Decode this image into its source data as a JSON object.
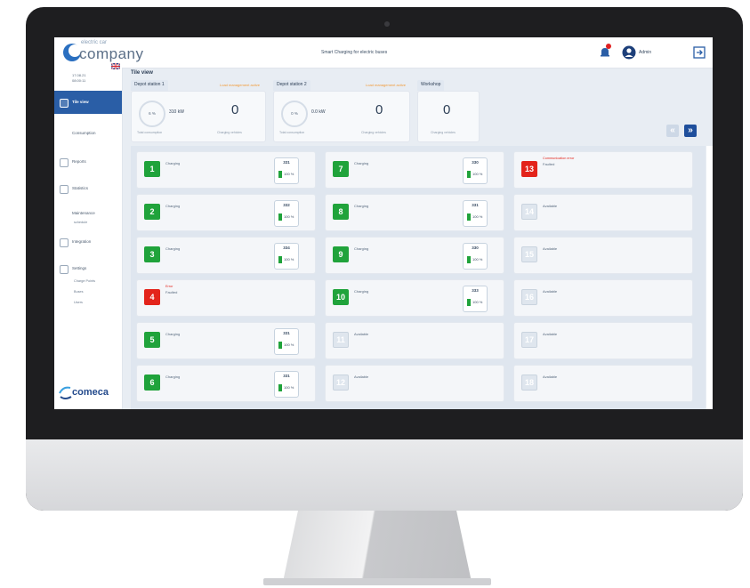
{
  "app": {
    "logo_small": "electric car",
    "logo_big": "company",
    "title": "Smart Charging for electric buses",
    "user_name": "Admin",
    "brand": "comeca"
  },
  "sidebar": {
    "info_line1": "17.08.21",
    "info_line2": "08:00:11",
    "items": [
      {
        "label": "Tile view"
      },
      {
        "label": "Consumption"
      },
      {
        "label": "Reports"
      },
      {
        "label": "Statistics"
      },
      {
        "label": "Maintenance"
      },
      {
        "label": "Integration"
      },
      {
        "label": "Settings"
      }
    ],
    "maintenance_sub": "schedule",
    "settings_sub": [
      "Charge Points",
      "Buses",
      "Users"
    ]
  },
  "main": {
    "view_title": "Tile view",
    "sections": [
      {
        "tab": "Depot station 1",
        "status": "Load management active",
        "gauge": "6 %",
        "power": "310 kW",
        "count": "0",
        "cap_left": "Total consumption",
        "cap_right": "Charging vehicles"
      },
      {
        "tab": "Depot station 2",
        "status": "Load management active",
        "gauge": "0 %",
        "power": "0.0 kW",
        "count": "0",
        "cap_left": "Total consumption",
        "cap_right": "Charging vehicles"
      },
      {
        "tab": "Workshop",
        "count": "0",
        "cap_right": "Charging vehicles"
      }
    ],
    "nav_prev": "«",
    "nav_next": "»",
    "tiles": [
      {
        "num": "1",
        "state": "g",
        "status": "Charging",
        "kw": "331",
        "pct": "100 %"
      },
      {
        "num": "7",
        "state": "g",
        "status": "Charging",
        "kw": "330",
        "pct": "100 %"
      },
      {
        "num": "13",
        "state": "r",
        "alert": "Communication error",
        "status": "Faulted"
      },
      {
        "num": "2",
        "state": "g",
        "status": "Charging",
        "kw": "332",
        "pct": "100 %"
      },
      {
        "num": "8",
        "state": "g",
        "status": "Charging",
        "kw": "331",
        "pct": "100 %"
      },
      {
        "num": "14",
        "state": "n",
        "status": "Available"
      },
      {
        "num": "3",
        "state": "g",
        "status": "Charging",
        "kw": "334",
        "pct": "100 %"
      },
      {
        "num": "9",
        "state": "g",
        "status": "Charging",
        "kw": "330",
        "pct": "100 %"
      },
      {
        "num": "15",
        "state": "n",
        "status": "Available"
      },
      {
        "num": "4",
        "state": "r",
        "alert": "Error",
        "status": "Faulted"
      },
      {
        "num": "10",
        "state": "g",
        "status": "Charging",
        "kw": "333",
        "pct": "100 %"
      },
      {
        "num": "16",
        "state": "n",
        "status": "Available"
      },
      {
        "num": "5",
        "state": "g",
        "status": "Charging",
        "kw": "331",
        "pct": "100 %"
      },
      {
        "num": "11",
        "state": "n",
        "status": "Available"
      },
      {
        "num": "17",
        "state": "n",
        "status": "Available"
      },
      {
        "num": "6",
        "state": "g",
        "status": "Charging",
        "kw": "331",
        "pct": "100 %"
      },
      {
        "num": "12",
        "state": "n",
        "status": "Available"
      },
      {
        "num": "18",
        "state": "n",
        "status": "Available"
      }
    ]
  },
  "colors": {
    "accent": "#2a5ea6",
    "charging": "#20a33b",
    "faulted": "#e3241b",
    "warning": "#f29a36"
  }
}
